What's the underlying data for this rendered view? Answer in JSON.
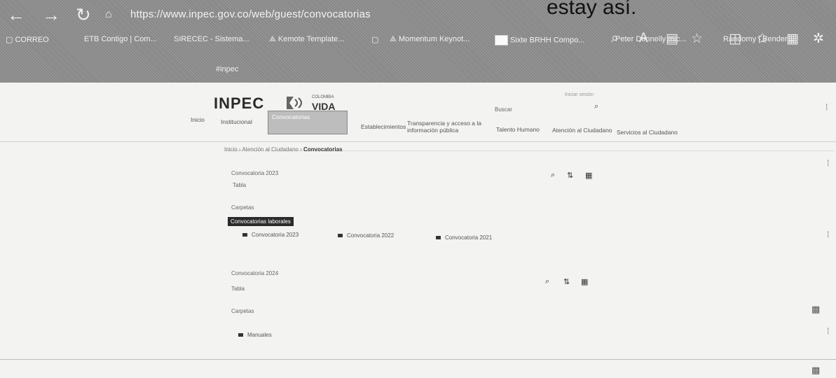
{
  "browser": {
    "back_glyph": "←",
    "forward_glyph": "→",
    "reload_glyph": "↻",
    "url": "https://www.inpec.gov.co/web/guest/convocatorias",
    "extra_text": "estay así.",
    "bookmarks": [
      {
        "label": "CORREO"
      },
      {
        "label": "ETB Contigo | Com..."
      },
      {
        "label": "SIRECEC - Sistema..."
      },
      {
        "label": "Kemote Template..."
      },
      {
        "label": "Momentum Keynot..."
      },
      {
        "label": "Sixte BRHH Compo..."
      },
      {
        "label": "Peter Donnelly mic..."
      },
      {
        "label": "Randomy | Bender..."
      }
    ],
    "banner_tag": "#inpec"
  },
  "page": {
    "logo": "INPEC",
    "logo_sub_top": "COLOMBIA",
    "logo_sub_main": "VIDA",
    "search_label": "Buscar",
    "top_faint": "Iniciar sesión",
    "nav": {
      "items": [
        {
          "label": "Inicio"
        },
        {
          "label": "Institucional"
        },
        {
          "label": "Establecimientos"
        },
        {
          "label": "Transparencia y acceso a la información pública"
        },
        {
          "label": "Talento Humano"
        },
        {
          "label": "Atención al Ciudadano"
        },
        {
          "label": "Servicios al Ciudadano"
        }
      ],
      "active": "Convocatorias"
    },
    "breadcrumb_prefix": "Inicio › Atención al Ciudadano ›",
    "breadcrumb_current": "Convocatorias",
    "section1": {
      "header": "Convocatoria 2023",
      "sub": "Tabla",
      "label": "Carpetas",
      "tag": "Convocatorias laborales",
      "folders": [
        "Convocatoria 2023",
        "Convocatoria 2022",
        "Convocatoria 2021"
      ]
    },
    "section2": {
      "header": "Convocatoria 2024",
      "sub": "Tabla",
      "label": "Carpetas",
      "folders": [
        "Manuales"
      ]
    }
  }
}
